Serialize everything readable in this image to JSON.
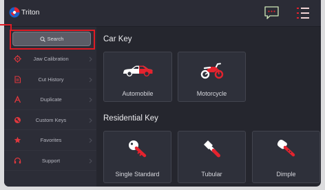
{
  "app": {
    "title": "Triton",
    "logo_icon": "triton-logo-icon"
  },
  "header": {
    "chat_icon": "chat-icon",
    "menu_icon": "menu-list-icon"
  },
  "sidebar": {
    "search": {
      "label": "Search",
      "icon": "search-icon"
    },
    "items": [
      {
        "label": "Jaw Calibration",
        "icon": "target-icon"
      },
      {
        "label": "Cut History",
        "icon": "document-icon"
      },
      {
        "label": "Duplicate",
        "icon": "duplicate-icon"
      },
      {
        "label": "Custom Keys",
        "icon": "custom-keys-icon"
      },
      {
        "label": "Favorites",
        "icon": "favorites-icon"
      },
      {
        "label": "Support",
        "icon": "support-icon"
      }
    ]
  },
  "main": {
    "car_key": {
      "title": "Car Key",
      "cards": [
        {
          "label": "Automobile",
          "icon": "car-icon"
        },
        {
          "label": "Motorcycle",
          "icon": "motorcycle-icon"
        }
      ]
    },
    "residential_key": {
      "title": "Residential Key",
      "cards": [
        {
          "label": "Single Standard",
          "icon": "single-standard-key-icon"
        },
        {
          "label": "Tubular",
          "icon": "tubular-key-icon"
        },
        {
          "label": "Dimple",
          "icon": "dimple-key-icon"
        }
      ]
    }
  },
  "colors": {
    "accent": "#e4232e",
    "screen_background": "#25262e",
    "sidebar_background": "#2c2d37",
    "card_background": "#2e303a",
    "highlight_annotation": "#e01b24"
  }
}
